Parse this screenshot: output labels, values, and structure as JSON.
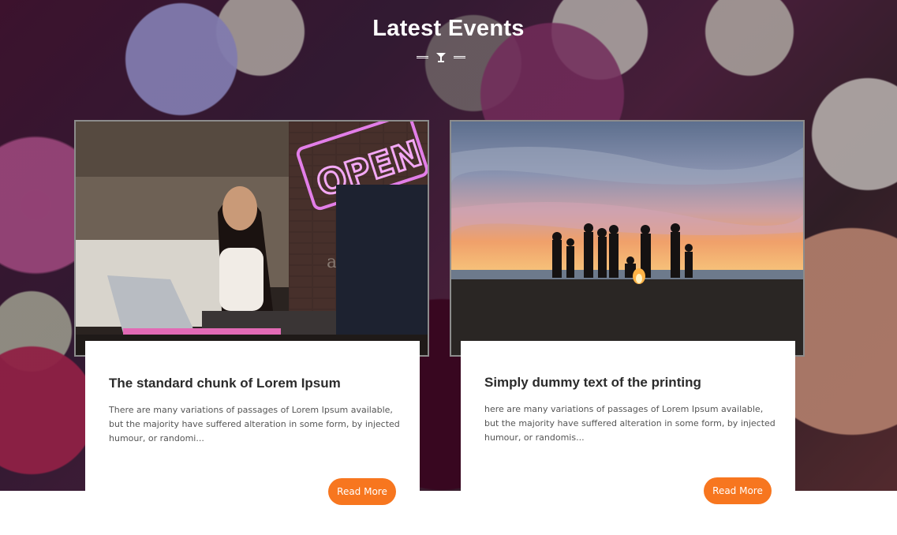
{
  "section": {
    "title": "Latest Events"
  },
  "colors": {
    "accent": "#f7761f",
    "title_text": "#2b2b2b",
    "body_text": "#555555"
  },
  "events": [
    {
      "title": "The standard chunk of Lorem Ipsum",
      "description": "There are many variations of passages of Lorem Ipsum available, but the majority have suffered alteration in some form, by injected humour, or randomi...",
      "button_label": "Read More",
      "image_text": "OPEN",
      "image_watermark": "aristocraz"
    },
    {
      "title": "Simply dummy text of the printing",
      "description": "here are many variations of passages of Lorem Ipsum available, but the majority have suffered alteration in some form, by injected humour, or randomis...",
      "button_label": "Read More"
    }
  ]
}
